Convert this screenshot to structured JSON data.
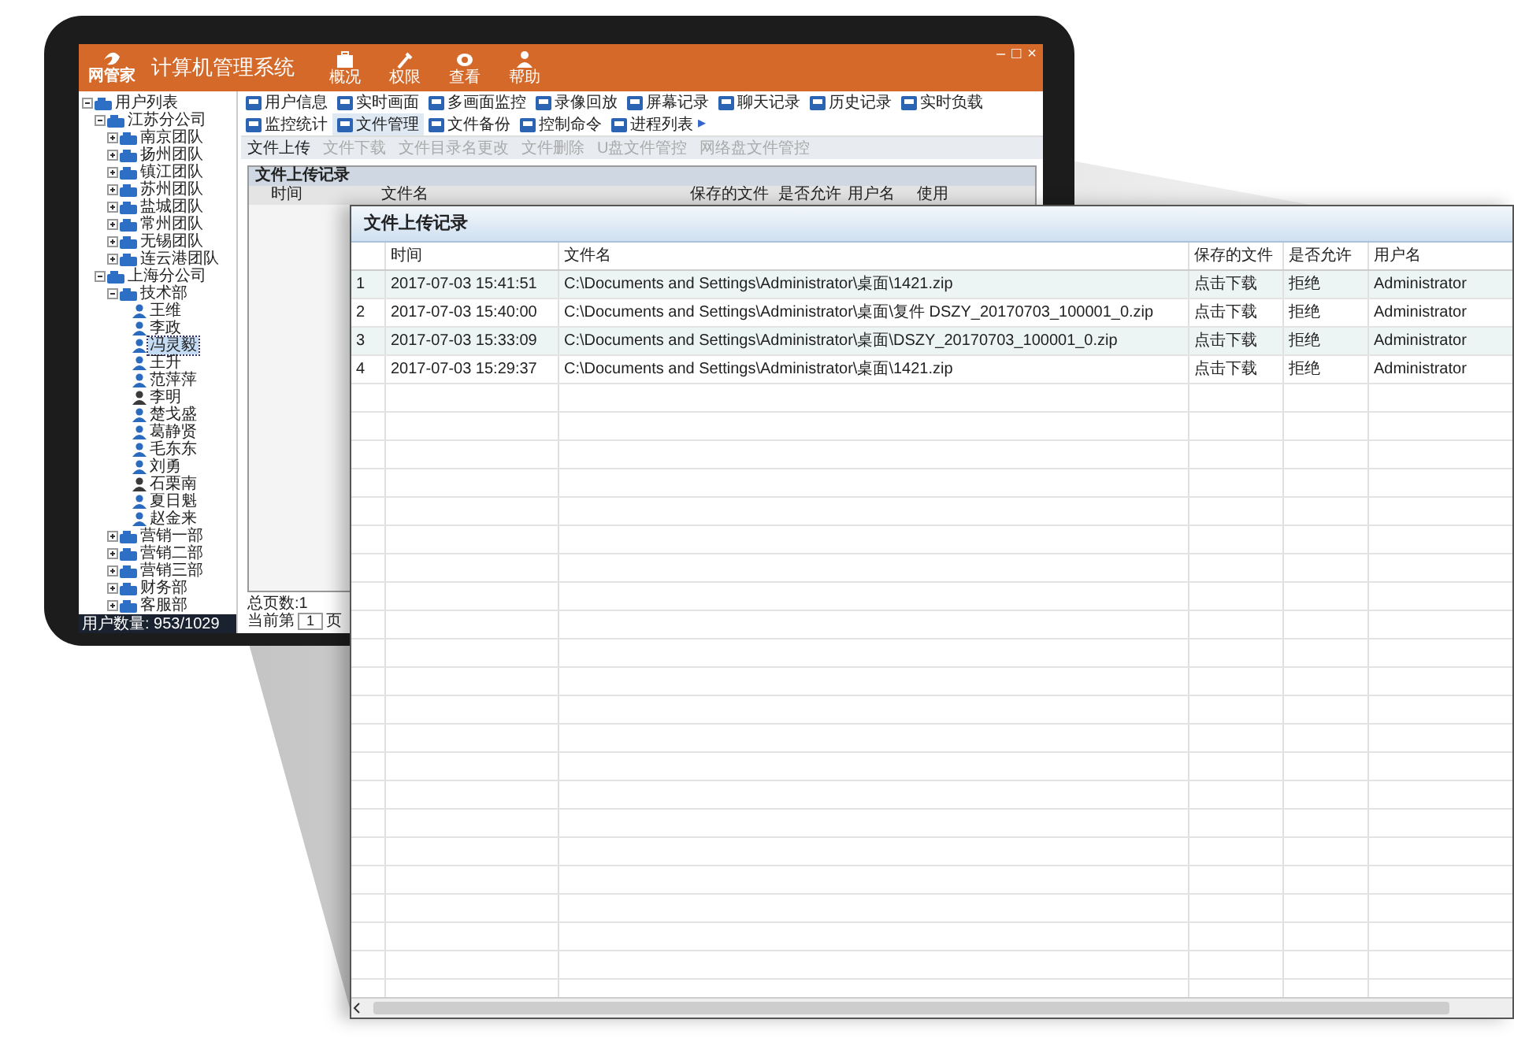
{
  "app": {
    "logo_text": "网管家",
    "title": "计算机管理系统",
    "window_controls": [
      "–",
      "□",
      "×"
    ],
    "header_buttons": [
      {
        "label": "概况",
        "kind": "bag"
      },
      {
        "label": "权限",
        "kind": "wrench"
      },
      {
        "label": "查看",
        "kind": "eye"
      },
      {
        "label": "帮助",
        "kind": "person"
      }
    ],
    "tree": {
      "label": "用户列表",
      "kind": "group",
      "expanded": true,
      "children": [
        {
          "label": "江苏分公司",
          "kind": "group",
          "expanded": true,
          "children": [
            {
              "label": "南京团队",
              "kind": "group",
              "expanded": false
            },
            {
              "label": "扬州团队",
              "kind": "group",
              "expanded": false
            },
            {
              "label": "镇江团队",
              "kind": "group",
              "expanded": false
            },
            {
              "label": "苏州团队",
              "kind": "group",
              "expanded": false
            },
            {
              "label": "盐城团队",
              "kind": "group",
              "expanded": false
            },
            {
              "label": "常州团队",
              "kind": "group",
              "expanded": false
            },
            {
              "label": "无锡团队",
              "kind": "group",
              "expanded": false
            },
            {
              "label": "连云港团队",
              "kind": "group",
              "expanded": false
            }
          ]
        },
        {
          "label": "上海分公司",
          "kind": "group",
          "expanded": true,
          "children": [
            {
              "label": "技术部",
              "kind": "group",
              "expanded": true,
              "children": [
                {
                  "label": "王维",
                  "kind": "person",
                  "online": true,
                  "selected": false
                },
                {
                  "label": "李政",
                  "kind": "person",
                  "online": true,
                  "selected": false
                },
                {
                  "label": "冯灵毅",
                  "kind": "person",
                  "online": true,
                  "selected": true
                },
                {
                  "label": "王升",
                  "kind": "person",
                  "online": true,
                  "selected": false
                },
                {
                  "label": "范萍萍",
                  "kind": "person",
                  "online": true,
                  "selected": false
                },
                {
                  "label": "李明",
                  "kind": "person",
                  "online": false,
                  "selected": false
                },
                {
                  "label": "楚戈盛",
                  "kind": "person",
                  "online": true,
                  "selected": false
                },
                {
                  "label": "葛静贤",
                  "kind": "person",
                  "online": true,
                  "selected": false
                },
                {
                  "label": "毛东东",
                  "kind": "person",
                  "online": true,
                  "selected": false
                },
                {
                  "label": "刘勇",
                  "kind": "person",
                  "online": true,
                  "selected": false
                },
                {
                  "label": "石栗南",
                  "kind": "person",
                  "online": false,
                  "selected": false
                },
                {
                  "label": "夏日魁",
                  "kind": "person",
                  "online": true,
                  "selected": false
                },
                {
                  "label": "赵金来",
                  "kind": "person",
                  "online": true,
                  "selected": false
                }
              ]
            },
            {
              "label": "营销一部",
              "kind": "group",
              "expanded": false
            },
            {
              "label": "营销二部",
              "kind": "group",
              "expanded": false
            },
            {
              "label": "营销三部",
              "kind": "group",
              "expanded": false
            },
            {
              "label": "财务部",
              "kind": "group",
              "expanded": false
            },
            {
              "label": "客服部",
              "kind": "group",
              "expanded": false
            }
          ]
        }
      ]
    },
    "status": "用户数量: 953/1029",
    "toolbar": [
      {
        "label": "用户信息",
        "selected": false
      },
      {
        "label": "实时画面",
        "selected": false
      },
      {
        "label": "多画面监控",
        "selected": false
      },
      {
        "label": "录像回放",
        "selected": false
      },
      {
        "label": "屏幕记录",
        "selected": false
      },
      {
        "label": "聊天记录",
        "selected": false
      },
      {
        "label": "历史记录",
        "selected": false
      },
      {
        "label": "实时负载",
        "selected": false
      },
      {
        "label": "监控统计",
        "selected": false
      },
      {
        "label": "文件管理",
        "selected": true
      },
      {
        "label": "文件备份",
        "selected": false
      },
      {
        "label": "控制命令",
        "selected": false
      },
      {
        "label": "进程列表",
        "selected": false
      }
    ],
    "toolbar_more": "▸",
    "subtabs": [
      {
        "label": "文件上传",
        "selected": true
      },
      {
        "label": "文件下载",
        "selected": false
      },
      {
        "label": "文件目录名更改",
        "selected": false
      },
      {
        "label": "文件删除",
        "selected": false
      },
      {
        "label": "U盘文件管控",
        "selected": false
      },
      {
        "label": "网络盘文件管控",
        "selected": false
      }
    ],
    "table": {
      "title": "文件上传记录",
      "columns": [
        "时间",
        "文件名",
        "保存的文件",
        "是否允许",
        "用户名",
        "使用"
      ]
    },
    "pager": {
      "total": "总页数:1",
      "current_label": "当前第",
      "page": "1",
      "unit": "页"
    }
  },
  "callout": {
    "title": "文件上传记录",
    "columns": [
      "时间",
      "文件名",
      "保存的文件",
      "是否允许",
      "用户名"
    ],
    "rows": [
      {
        "index": "1",
        "cells": [
          "2017-07-03 15:41:51",
          "C:\\Documents and Settings\\Administrator\\桌面\\1421.zip",
          "点击下载",
          "拒绝",
          "Administrator"
        ]
      },
      {
        "index": "2",
        "cells": [
          "2017-07-03 15:40:00",
          "C:\\Documents and Settings\\Administrator\\桌面\\复件 DSZY_20170703_100001_0.zip",
          "点击下载",
          "拒绝",
          "Administrator"
        ]
      },
      {
        "index": "3",
        "cells": [
          "2017-07-03 15:33:09",
          "C:\\Documents and Settings\\Administrator\\桌面\\DSZY_20170703_100001_0.zip",
          "点击下载",
          "拒绝",
          "Administrator"
        ]
      },
      {
        "index": "4",
        "cells": [
          "2017-07-03 15:29:37",
          "C:\\Documents and Settings\\Administrator\\桌面\\1421.zip",
          "点击下载",
          "拒绝",
          "Administrator"
        ]
      }
    ]
  }
}
